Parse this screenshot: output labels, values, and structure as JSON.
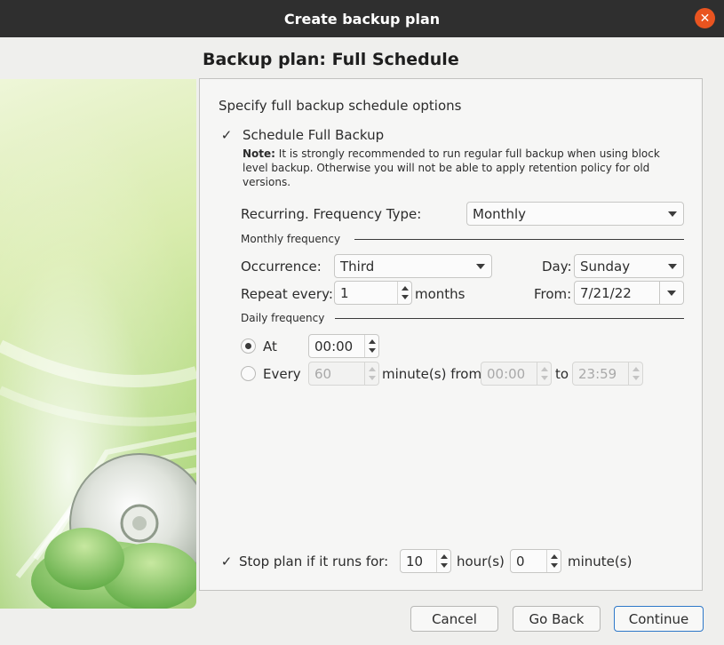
{
  "window": {
    "title": "Create backup plan",
    "close_glyph": "✕"
  },
  "heading": "Backup plan: Full Schedule",
  "panel": {
    "intro": "Specify full backup schedule options",
    "schedule_full_backup": {
      "label": "Schedule Full Backup",
      "checked": true,
      "check_glyph": "✓"
    },
    "note": {
      "prefix": "Note:",
      "text": " It is strongly recommended to run regular full backup when using block level backup. Otherwise you will not be able to apply retention policy for old versions."
    },
    "frequency_type": {
      "label": "Recurring. Frequency Type:",
      "value": "Monthly"
    },
    "monthly": {
      "group_label": "Monthly frequency",
      "occurrence_label": "Occurrence:",
      "occurrence_value": "Third",
      "day_label": "Day:",
      "day_value": "Sunday",
      "repeat_label": "Repeat every:",
      "repeat_value": "1",
      "repeat_unit": "months",
      "from_label": "From:",
      "from_value": "7/21/22"
    },
    "daily": {
      "group_label": "Daily frequency",
      "at_label": "At",
      "at_selected": true,
      "at_value": "00:00",
      "every_label": "Every",
      "every_value": "60",
      "every_unit_from": "minute(s) from",
      "from_time": "00:00",
      "to_label": "to",
      "to_time": "23:59"
    },
    "stop_plan": {
      "label": "Stop plan if it runs for:",
      "checked": true,
      "check_glyph": "✓",
      "hours_value": "10",
      "hours_unit": "hour(s)",
      "minutes_value": "0",
      "minutes_unit": "minute(s)"
    }
  },
  "footer": {
    "cancel": "Cancel",
    "back": "Go Back",
    "continue": "Continue"
  },
  "colors": {
    "titlebar": "#2f2f2f",
    "close": "#e95420",
    "primary_border": "#2e78c9",
    "art_green": "#9fcd72"
  }
}
